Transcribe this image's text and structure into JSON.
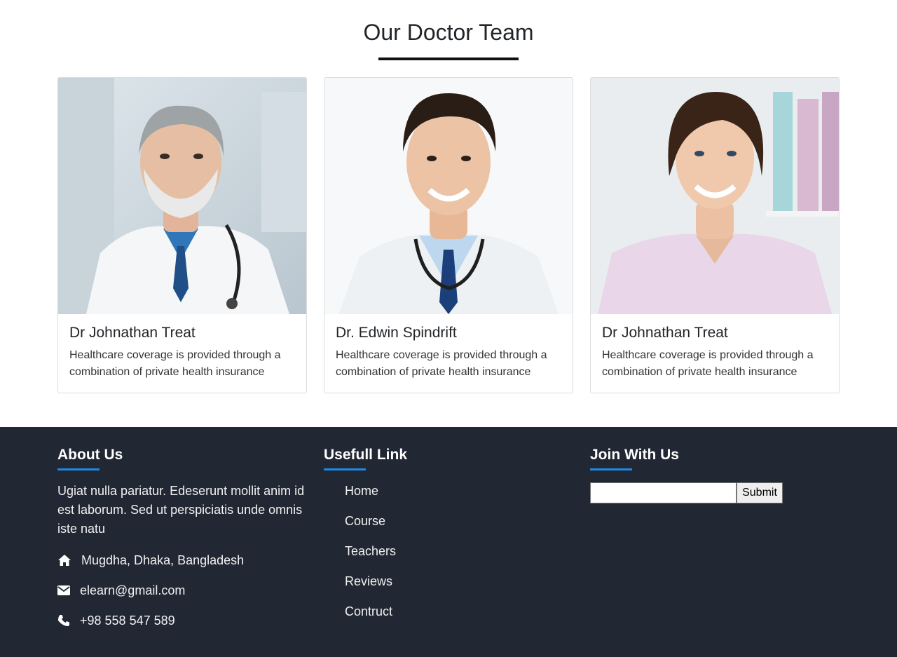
{
  "team": {
    "title": "Our Doctor Team",
    "doctors": [
      {
        "name": "Dr Johnathan Treat",
        "description": "Healthcare coverage is provided through a combination of private health insurance"
      },
      {
        "name": "Dr. Edwin Spindrift",
        "description": "Healthcare coverage is provided through a combination of private health insurance"
      },
      {
        "name": "Dr Johnathan Treat",
        "description": "Healthcare coverage is provided through a combination of private health insurance"
      }
    ]
  },
  "footer": {
    "about": {
      "heading": "About Us",
      "text": "Ugiat nulla pariatur. Edeserunt mollit anim id est laborum. Sed ut perspiciatis unde omnis iste natu",
      "address": "Mugdha, Dhaka, Bangladesh",
      "email": "elearn@gmail.com",
      "phone": "+98 558 547 589"
    },
    "links": {
      "heading": "Usefull Link",
      "items": [
        "Home",
        "Course",
        "Teachers",
        "Reviews",
        "Contruct"
      ]
    },
    "join": {
      "heading": "Join With Us",
      "input_value": "",
      "submit_label": "Submit"
    }
  },
  "colors": {
    "footer_bg": "#212733",
    "accent_blue": "#1e88e5",
    "title_underline": "#111111"
  },
  "icons": [
    "home-icon",
    "envelope-icon",
    "phone-icon"
  ]
}
